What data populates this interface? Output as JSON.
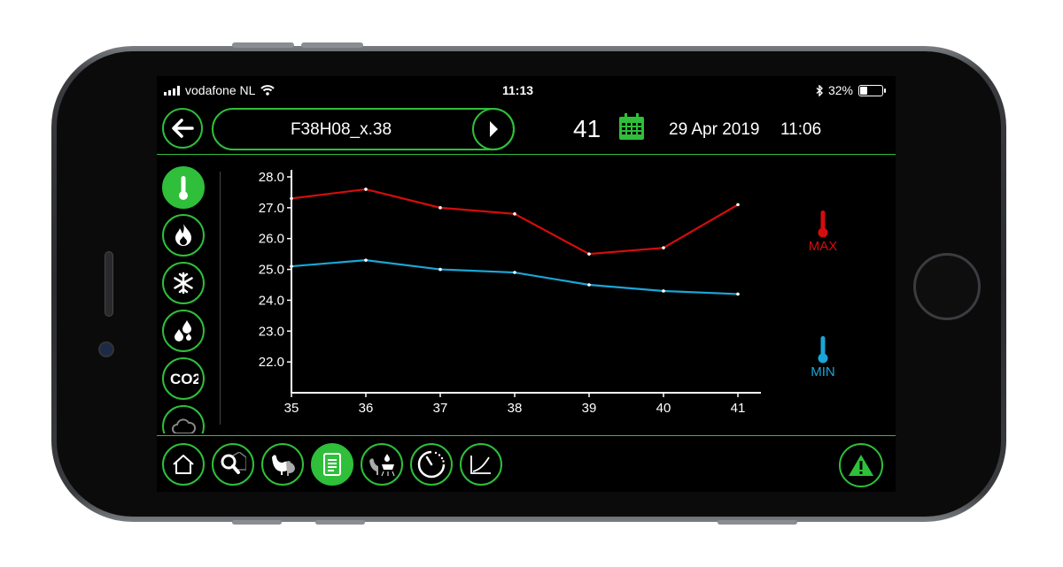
{
  "status_bar": {
    "carrier": "vodafone NL",
    "time": "11:13",
    "battery": "32%"
  },
  "header": {
    "device_name": "F38H08_x.38",
    "day": "41",
    "date": "29 Apr 2019",
    "time": "11:06"
  },
  "sidebar": {
    "items": [
      {
        "icon": "thermometer-icon",
        "active": true
      },
      {
        "icon": "flame-icon",
        "active": false
      },
      {
        "icon": "snowflake-icon",
        "active": false
      },
      {
        "icon": "water-drops-icon",
        "active": false
      },
      {
        "icon": "co2-icon",
        "label": "CO2",
        "active": false
      },
      {
        "icon": "cloud-icon",
        "active": false
      }
    ]
  },
  "legend": {
    "max_label": "MAX",
    "min_label": "MIN",
    "max_color": "#d40d0d",
    "min_color": "#1aa6d8"
  },
  "footer": {
    "items": [
      {
        "icon": "home-icon"
      },
      {
        "icon": "search-house-icon"
      },
      {
        "icon": "chickens-icon"
      },
      {
        "icon": "report-icon",
        "active": true
      },
      {
        "icon": "chicken-feed-water-icon"
      },
      {
        "icon": "clock-icon"
      },
      {
        "icon": "growth-curve-icon"
      }
    ],
    "alarm_icon": "warning-icon"
  },
  "colors": {
    "accent": "#2fbf3a",
    "background": "#000000"
  },
  "chart_data": {
    "type": "line",
    "x": [
      35,
      36,
      37,
      38,
      39,
      40,
      41
    ],
    "series": [
      {
        "name": "MAX",
        "color": "#d40d0d",
        "values": [
          27.3,
          27.6,
          27.0,
          26.8,
          25.5,
          25.7,
          27.1
        ]
      },
      {
        "name": "MIN",
        "color": "#1aa6d8",
        "values": [
          25.1,
          25.3,
          25.0,
          24.9,
          24.5,
          24.3,
          24.2
        ]
      }
    ],
    "y_ticks": [
      "28.0",
      "27.0",
      "26.0",
      "25.0",
      "24.0",
      "23.0",
      "22.0"
    ],
    "ylim": [
      21.0,
      28.0
    ],
    "xlim": [
      35,
      41
    ],
    "grid": false
  }
}
